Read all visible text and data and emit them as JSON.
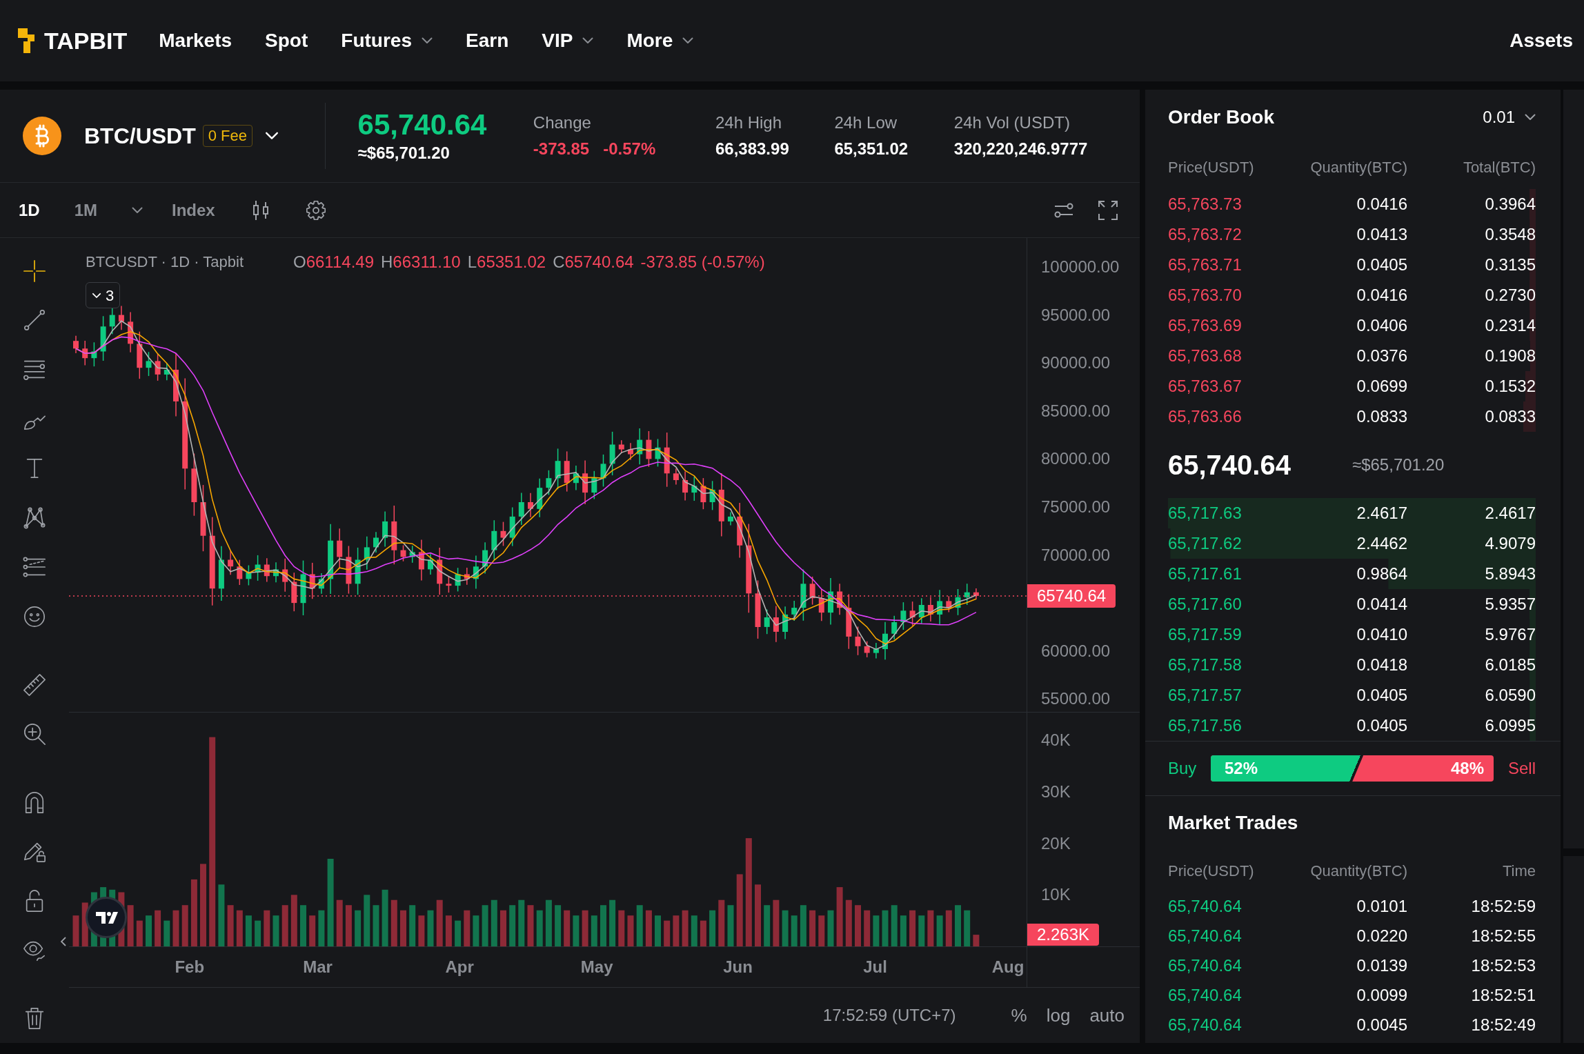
{
  "header": {
    "logo": "TAPBIT",
    "nav": [
      {
        "label": "Markets",
        "dropdown": false
      },
      {
        "label": "Spot",
        "dropdown": false
      },
      {
        "label": "Futures",
        "dropdown": true
      },
      {
        "label": "Earn",
        "dropdown": false
      },
      {
        "label": "VIP",
        "dropdown": true
      },
      {
        "label": "More",
        "dropdown": true
      }
    ],
    "assets": "Assets"
  },
  "ticker": {
    "pair": "BTC/USDT",
    "fee_badge": "0 Fee",
    "last_price": "65,740.64",
    "rising": true,
    "last_price_usd": "≈$65,701.20",
    "stats": [
      {
        "label": "Change",
        "values": [
          "-373.85",
          "-0.57%"
        ],
        "kind": "change"
      },
      {
        "label": "24h High",
        "values": [
          "66,383.99"
        ],
        "kind": "plain"
      },
      {
        "label": "24h Low",
        "values": [
          "65,351.02"
        ],
        "kind": "plain"
      },
      {
        "label": "24h Vol (USDT)",
        "values": [
          "320,220,246.9777"
        ],
        "kind": "plain"
      }
    ]
  },
  "chart_toolbar": {
    "intervals": [
      {
        "label": "1D",
        "selected": true
      },
      {
        "label": "1M",
        "selected": false
      }
    ],
    "index_button": "Index"
  },
  "drawing_tools": [
    {
      "selected": true
    },
    {
      "selected": false
    },
    {
      "selected": false
    },
    {
      "selected": false
    },
    {
      "selected": false
    },
    {
      "selected": false
    },
    {
      "selected": false
    },
    {
      "selected": false
    },
    {
      "selected": false
    },
    {
      "selected": false
    },
    {
      "selected": false
    },
    {
      "selected": false
    },
    {
      "selected": false
    },
    {
      "selected": false
    },
    {
      "selected": false
    }
  ],
  "chart": {
    "legend": {
      "title": "BTCUSDT · 1D · Tapbit",
      "ohlc": [
        {
          "label": "O",
          "value": "66114.49"
        },
        {
          "label": "H",
          "value": "66311.10"
        },
        {
          "label": "L",
          "value": "65351.02"
        },
        {
          "label": "C",
          "value": "65740.64"
        }
      ],
      "change": "-373.85 (-0.57%)"
    },
    "indicators_count": "3",
    "price_axis": [
      "100000.00",
      "95000.00",
      "90000.00",
      "85000.00",
      "80000.00",
      "75000.00",
      "70000.00",
      "60000.00",
      "55000.00"
    ],
    "price_label": "65740.64",
    "volume": {
      "axis_labels": [
        "40K",
        "30K",
        "20K",
        "10K"
      ],
      "value_label": "2.263K"
    },
    "time_axis": [
      "Feb",
      "Mar",
      "Apr",
      "May",
      "Jun",
      "Jul",
      "Aug"
    ],
    "footer": {
      "time": "17:52:59 (UTC+7)",
      "buttons": [
        "%",
        "log",
        "auto"
      ]
    }
  },
  "order_book": {
    "title": "Order Book",
    "precision": "0.01",
    "columns": [
      "Price(USDT)",
      "Quantity(BTC)",
      "Total(BTC)"
    ],
    "asks": [
      {
        "price": "65,763.73",
        "quantity": "0.0416",
        "total": "0.3964"
      },
      {
        "price": "65,763.72",
        "quantity": "0.0413",
        "total": "0.3548"
      },
      {
        "price": "65,763.71",
        "quantity": "0.0405",
        "total": "0.3135"
      },
      {
        "price": "65,763.70",
        "quantity": "0.0416",
        "total": "0.2730"
      },
      {
        "price": "65,763.69",
        "quantity": "0.0406",
        "total": "0.2314"
      },
      {
        "price": "65,763.68",
        "quantity": "0.0376",
        "total": "0.1908"
      },
      {
        "price": "65,763.67",
        "quantity": "0.0699",
        "total": "0.1532"
      },
      {
        "price": "65,763.66",
        "quantity": "0.0833",
        "total": "0.0833"
      }
    ],
    "mid_price": "65,740.64",
    "mid_price_usd": "≈$65,701.20",
    "bids": [
      {
        "price": "65,717.63",
        "quantity": "2.4617",
        "total": "2.4617"
      },
      {
        "price": "65,717.62",
        "quantity": "2.4462",
        "total": "4.9079"
      },
      {
        "price": "65,717.61",
        "quantity": "0.9864",
        "total": "5.8943"
      },
      {
        "price": "65,717.60",
        "quantity": "0.0414",
        "total": "5.9357"
      },
      {
        "price": "65,717.59",
        "quantity": "0.0410",
        "total": "5.9767"
      },
      {
        "price": "65,717.58",
        "quantity": "0.0418",
        "total": "6.0185"
      },
      {
        "price": "65,717.57",
        "quantity": "0.0405",
        "total": "6.0590"
      },
      {
        "price": "65,717.56",
        "quantity": "0.0405",
        "total": "6.0995"
      }
    ],
    "buy_sell": {
      "buy_label": "Buy",
      "buy_percent": "52%",
      "sell_percent": "48%",
      "sell_label": "Sell",
      "level": 0.52
    }
  },
  "market_trades": {
    "title": "Market Trades",
    "columns": [
      "Price(USDT)",
      "Quantity(BTC)",
      "Time"
    ],
    "rows": [
      {
        "price": "65,740.64",
        "quantity": "0.0101",
        "time": "18:52:59",
        "buy": true
      },
      {
        "price": "65,740.64",
        "quantity": "0.0220",
        "time": "18:52:55",
        "buy": true
      },
      {
        "price": "65,740.64",
        "quantity": "0.0139",
        "time": "18:52:53",
        "buy": true
      },
      {
        "price": "65,740.64",
        "quantity": "0.0099",
        "time": "18:52:51",
        "buy": true
      },
      {
        "price": "65,740.64",
        "quantity": "0.0045",
        "time": "18:52:49",
        "buy": true
      }
    ]
  }
}
